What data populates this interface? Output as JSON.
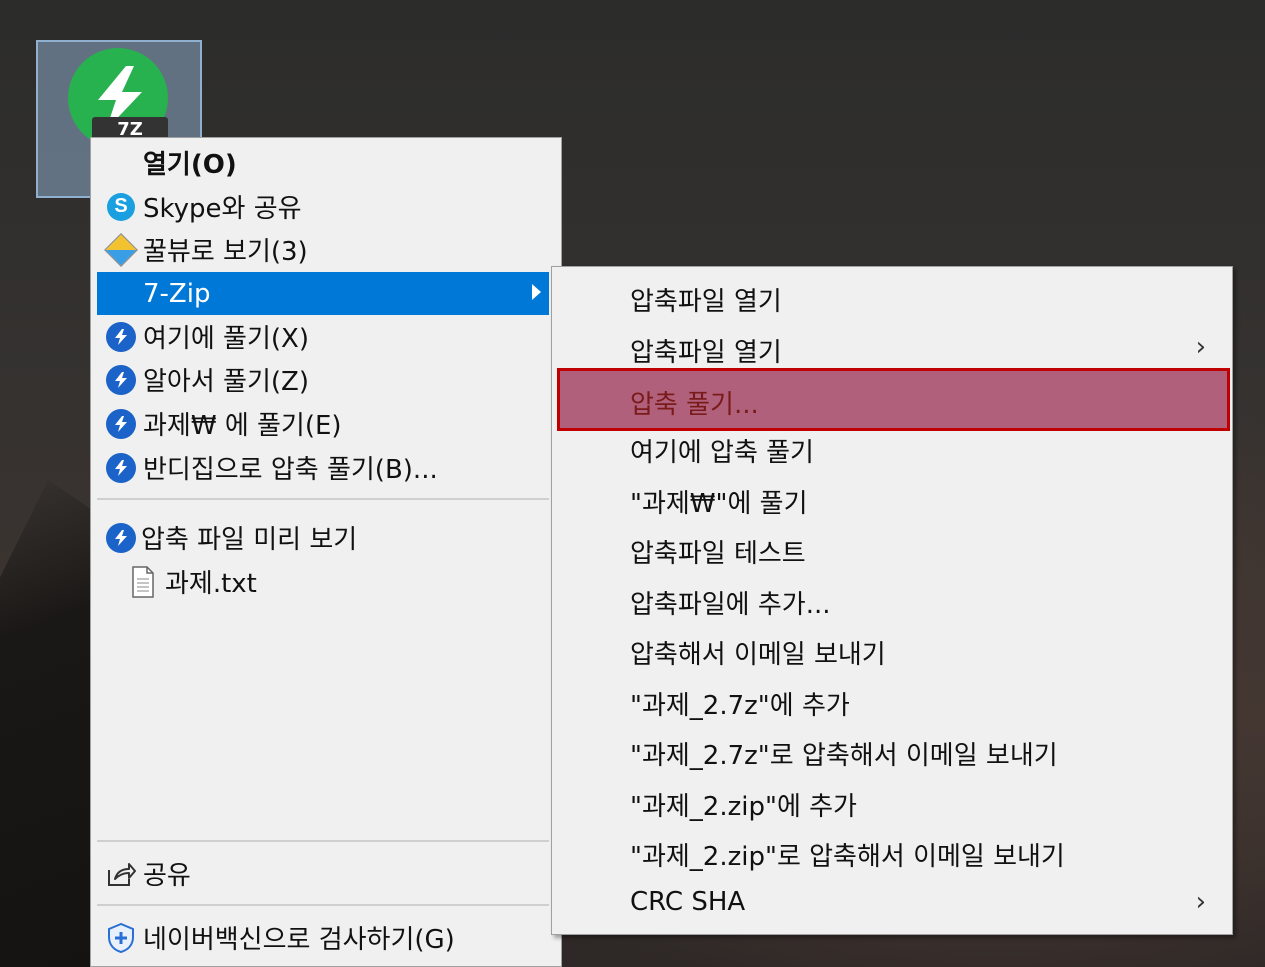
{
  "desktop": {
    "icon_badge": "7Z",
    "icon_name": "7zip-archive-icon"
  },
  "context_menu": {
    "items": [
      {
        "label": "열기(O)",
        "icon": null,
        "bold": true
      },
      {
        "label": "Skype와 공유",
        "icon": "skype-icon"
      },
      {
        "label": "꿀뷰로 보기(3)",
        "icon": "honeyview-icon"
      },
      {
        "label": "7-Zip",
        "icon": null,
        "selected": true,
        "submenu": true
      },
      {
        "label": "여기에 풀기(X)",
        "icon": "bandizip-icon"
      },
      {
        "label": "알아서 풀기(Z)",
        "icon": "bandizip-icon"
      },
      {
        "label": "과제₩ 에 풀기(E)",
        "icon": "bandizip-icon"
      },
      {
        "label": "반디집으로 압축 풀기(B)...",
        "icon": "bandizip-icon"
      },
      {
        "label": "압축 파일 미리 보기",
        "icon": "bandizip-icon"
      },
      {
        "label": "과제.txt",
        "icon": "text-file-icon"
      },
      {
        "label": "공유",
        "icon": "share-icon"
      },
      {
        "label": "네이버백신으로 검사하기(G)",
        "icon": "shield-icon"
      }
    ]
  },
  "submenu": {
    "items": [
      {
        "label": "압축파일 열기",
        "chevron": false
      },
      {
        "label": "압축파일 열기",
        "chevron": true
      },
      {
        "label": "압축 풀기...",
        "highlighted": true
      },
      {
        "label": "여기에 압축 풀기"
      },
      {
        "label": "\"과제₩\"에 풀기"
      },
      {
        "label": "압축파일 테스트"
      },
      {
        "label": "압축파일에 추가..."
      },
      {
        "label": "압축해서 이메일 보내기"
      },
      {
        "label": "\"과제_2.7z\"에 추가"
      },
      {
        "label": "\"과제_2.7z\"로 압축해서 이메일 보내기"
      },
      {
        "label": "\"과제_2.zip\"에 추가"
      },
      {
        "label": "\"과제_2.zip\"로 압축해서 이메일 보내기"
      },
      {
        "label": "CRC SHA",
        "chevron": true
      }
    ],
    "chevron_glyph": "›"
  },
  "colors": {
    "selected_bg": "#0078d7",
    "highlight_fill": "#b0607a",
    "highlight_border": "#c00000",
    "menu_bg": "#f0f0f0"
  }
}
